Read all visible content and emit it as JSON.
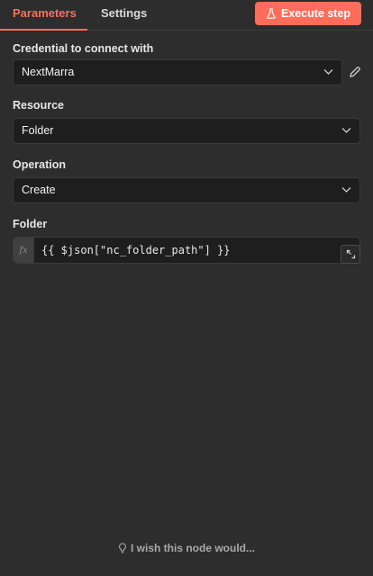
{
  "tabs": {
    "parameters": "Parameters",
    "settings": "Settings"
  },
  "toolbar": {
    "execute_label": "Execute step"
  },
  "credential": {
    "label": "Credential to connect with",
    "value": "NextMarra"
  },
  "resource": {
    "label": "Resource",
    "value": "Folder"
  },
  "operation": {
    "label": "Operation",
    "value": "Create"
  },
  "folder": {
    "label": "Folder",
    "fx": "fx",
    "expression": "{{ $json[\"nc_folder_path\"] }}"
  },
  "footer": {
    "wish": "I wish this node would..."
  },
  "colors": {
    "accent": "#ff6d5a",
    "background": "#2d2d2d",
    "input_bg": "#1e1e1e"
  },
  "icons": [
    "flask-icon",
    "chevron-down-icon",
    "pencil-icon",
    "expand-icon",
    "lightbulb-icon"
  ]
}
